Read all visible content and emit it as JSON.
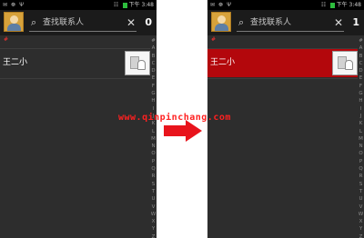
{
  "left_screen": {
    "status": {
      "icons": "✉ ☸ Ψ",
      "signal": "☷",
      "time": "下午 3:48"
    },
    "search": {
      "placeholder": "查找联系人",
      "search_icon": "magnifier",
      "clear_icon": "✕"
    },
    "count": "0",
    "section_letter": "#",
    "contact": {
      "name": "王二小",
      "selected": false
    }
  },
  "right_screen": {
    "status": {
      "icons": "✉ ☸ Ψ",
      "signal": "☷",
      "time": "下午 3:48"
    },
    "search": {
      "placeholder": "查找联系人",
      "search_icon": "magnifier",
      "clear_icon": "✕"
    },
    "count": "1",
    "section_letter": "#",
    "contact": {
      "name": "王二小",
      "selected": true
    }
  },
  "index_letters": [
    "#",
    "A",
    "B",
    "C",
    "D",
    "E",
    "F",
    "G",
    "H",
    "I",
    "J",
    "K",
    "L",
    "M",
    "N",
    "O",
    "P",
    "Q",
    "R",
    "S",
    "T",
    "U",
    "V",
    "W",
    "X",
    "Y",
    "Z"
  ],
  "watermark": "www.qinpinchang.com",
  "colors": {
    "selected_row": "#b3070c",
    "arrow": "#e8141c",
    "watermark": "#ff2020"
  }
}
